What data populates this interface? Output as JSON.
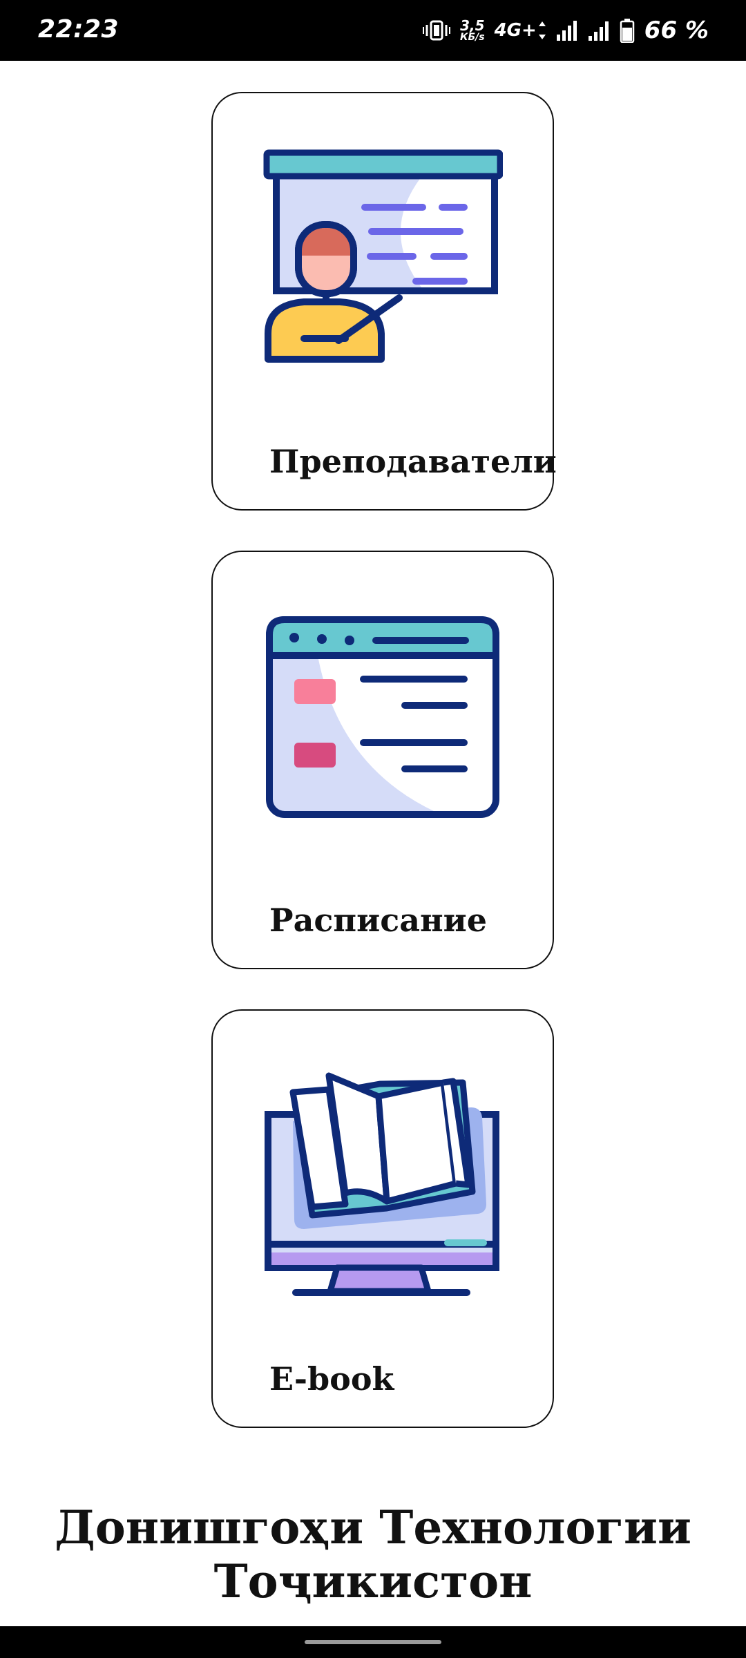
{
  "status_bar": {
    "time": "22:23",
    "net_speed_value": "3,5",
    "net_speed_unit": "КБ/s",
    "network_type": "4G+",
    "battery_percent": "66 %"
  },
  "cards": [
    {
      "label": "Преподаватели",
      "icon": "teacher-presentation-icon"
    },
    {
      "label": "Расписание",
      "icon": "schedule-window-icon"
    },
    {
      "label": "E-book",
      "icon": "ebook-monitor-icon"
    }
  ],
  "footer": {
    "title_line1": "Донишгоҳи Технологии",
    "title_line2": "Тоҷикистон"
  },
  "colors": {
    "outline": "#0e2a78",
    "teal": "#67c8d0",
    "board_bg": "#d5dcf8",
    "lines_purple": "#6b66e8",
    "skin": "#fbbcb1",
    "hair": "#d86a5b",
    "shirt": "#fdcb52",
    "pink": "#f87f9a",
    "magenta": "#d74b7f",
    "book_shadow": "#9db2ee",
    "stand_purple": "#b69af0"
  }
}
